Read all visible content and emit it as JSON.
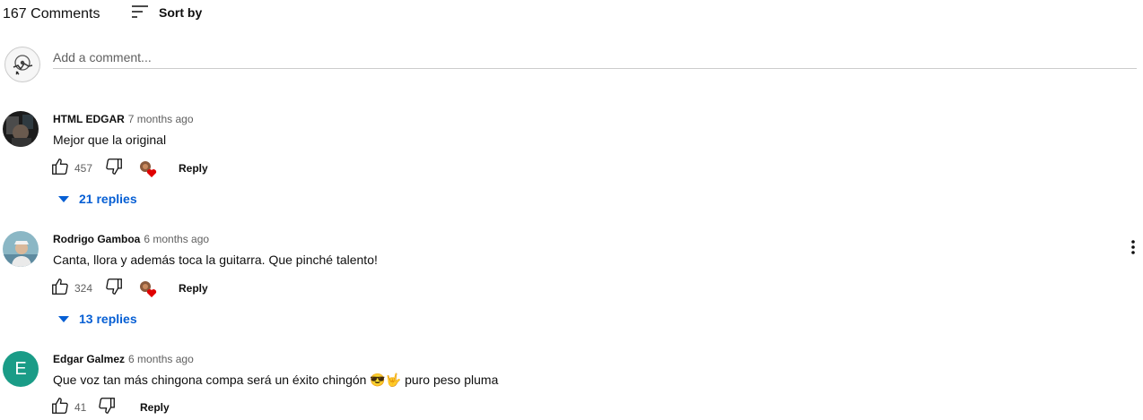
{
  "comments_header": {
    "count_label": "167 Comments",
    "sort_label": "Sort by",
    "sort_icon": "sort-icon"
  },
  "add_comment": {
    "placeholder": "Add a comment..."
  },
  "comments": [
    {
      "author": "HTML EDGAR",
      "time": "7 months ago",
      "text": "Mejor que la original",
      "likes": "457",
      "reply_label": "Reply",
      "creator_heart": true,
      "replies_label": "21 replies"
    },
    {
      "author": "Rodrigo Gamboa",
      "time": "6 months ago",
      "text": "Canta, llora y además toca la guitarra. Que pinché talento!",
      "likes": "324",
      "reply_label": "Reply",
      "creator_heart": true,
      "replies_label": "13 replies"
    },
    {
      "author": "Edgar Galmez",
      "avatar_letter": "E",
      "time": "6 months ago",
      "text": "Que voz tan más chingona compa  será un éxito chingón 😎🤟  puro peso pluma",
      "likes": "41",
      "reply_label": "Reply",
      "creator_heart": false
    }
  ],
  "colors": {
    "link_blue": "#065fd4",
    "secondary_text": "#606060",
    "heart_red": "#e00000",
    "letter_avatar_bg": "#1a9c87"
  }
}
